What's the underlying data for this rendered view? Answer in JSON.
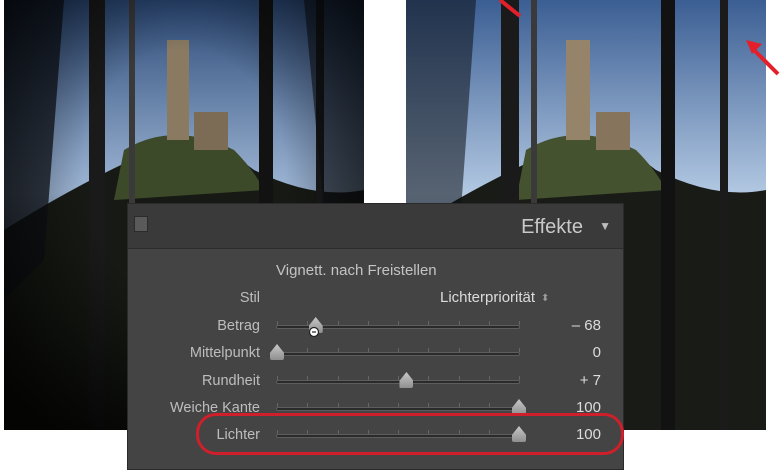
{
  "panel": {
    "title": "Effekte",
    "collapse_icon": "triangle-down-icon",
    "section_title": "Vignett. nach Freistellen"
  },
  "rows": {
    "stil": {
      "label": "Stil",
      "value": "Lichterpriorität",
      "icon": "up-down-arrows-icon"
    },
    "betrag": {
      "label": "Betrag",
      "value": "– 68",
      "level": -0.68
    },
    "mittelpunkt": {
      "label": "Mittelpunkt",
      "value": "0",
      "level": 0
    },
    "rundheit": {
      "label": "Rundheit",
      "value": "+ 7",
      "level": 0.07
    },
    "weiche_kante": {
      "label": "Weiche Kante",
      "value": "100",
      "level": 1.0
    },
    "lichter": {
      "label": "Lichter",
      "value": "100",
      "level": 1.0
    }
  },
  "colors": {
    "panel_bg": "#444444",
    "highlight": "#cf1f2a"
  }
}
